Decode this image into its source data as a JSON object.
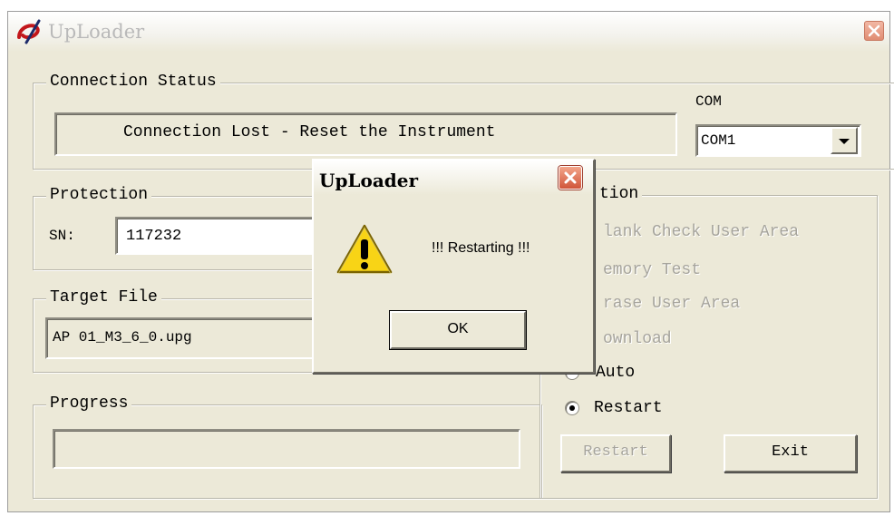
{
  "window": {
    "title": "UpLoader"
  },
  "connection": {
    "legend": "Connection Status",
    "status_text": "Connection Lost - Reset the Instrument",
    "com_label": "COM",
    "com_selected": "COM1"
  },
  "protection": {
    "legend": "Protection",
    "sn_label": "SN:",
    "sn_value": "117232"
  },
  "target": {
    "legend": "Target File",
    "filename": "AP 01_M3_6_0.upg"
  },
  "progress": {
    "legend": "Progress",
    "value": 0
  },
  "action": {
    "legend_fragment": "tion",
    "options": [
      {
        "label": "lank Check User Area",
        "enabled": false
      },
      {
        "label": "emory Test",
        "enabled": false
      },
      {
        "label": "rase User Area",
        "enabled": false
      },
      {
        "label": "ownload",
        "enabled": false
      },
      {
        "label": "Auto",
        "enabled": true
      },
      {
        "label": "Restart",
        "enabled": true,
        "selected": true
      }
    ],
    "restart_button": "Restart",
    "exit_button": "Exit"
  },
  "dialog": {
    "title": "UpLoader",
    "message": "!!! Restarting !!!",
    "ok_label": "OK"
  },
  "colors": {
    "window_bg": "#ece9d8",
    "disabled_text": "#a6a49c",
    "close_red": "#d0553a"
  }
}
